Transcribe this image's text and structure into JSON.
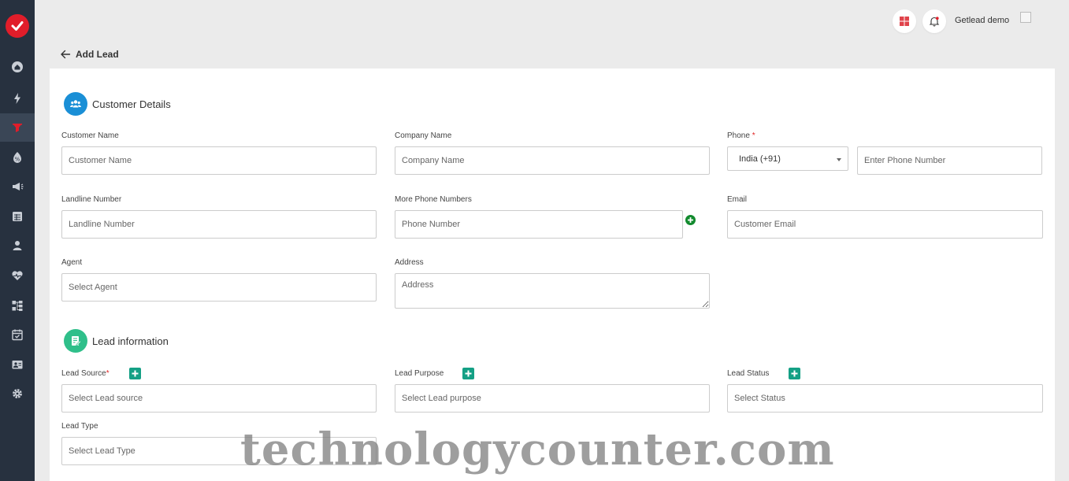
{
  "header": {
    "user_name": "Getlead demo",
    "grid_icon": "apps-grid-icon",
    "bell_icon": "notification-bell-icon"
  },
  "sidebar": {
    "items": [
      {
        "icon": "home-icon"
      },
      {
        "icon": "bolt-icon"
      },
      {
        "icon": "funnel-icon",
        "active": true
      },
      {
        "icon": "tag-icon"
      },
      {
        "icon": "megaphone-icon"
      },
      {
        "icon": "table-icon"
      },
      {
        "icon": "user-icon"
      },
      {
        "icon": "heart-pulse-icon"
      },
      {
        "icon": "workflow-icon"
      },
      {
        "icon": "calendar-check-icon"
      },
      {
        "icon": "id-card-icon"
      },
      {
        "icon": "gear-icon"
      }
    ]
  },
  "page": {
    "back_label": "Add Lead"
  },
  "customer_details": {
    "title": "Customer Details",
    "customer_name": {
      "label": "Customer Name",
      "placeholder": "Customer Name"
    },
    "company_name": {
      "label": "Company Name",
      "placeholder": "Company Name"
    },
    "phone": {
      "label": "Phone",
      "required_mark": "*",
      "country": "India (+91)",
      "placeholder": "Enter Phone Number"
    },
    "landline": {
      "label": "Landline Number",
      "placeholder": "Landline Number"
    },
    "more_phone": {
      "label": "More Phone Numbers",
      "placeholder": "Phone Number"
    },
    "email": {
      "label": "Email",
      "placeholder": "Customer Email"
    },
    "agent": {
      "label": "Agent",
      "placeholder": "Select Agent"
    },
    "address": {
      "label": "Address",
      "placeholder": "Address"
    }
  },
  "lead_information": {
    "title": "Lead information",
    "lead_source": {
      "label": "Lead Source",
      "required_mark": "*",
      "placeholder": "Select Lead source"
    },
    "lead_purpose": {
      "label": "Lead Purpose",
      "placeholder": "Select Lead purpose"
    },
    "lead_status": {
      "label": "Lead Status",
      "placeholder": "Select Status"
    },
    "lead_type": {
      "label": "Lead Type",
      "placeholder": "Select Lead Type"
    }
  },
  "watermark": "technologycounter.com",
  "colors": {
    "sidebar_bg": "#27313f",
    "brand_red": "#e11d2a",
    "accent_blue": "#1a8fd6",
    "accent_green": "#2fbf8a",
    "add_button": "#14a085"
  }
}
